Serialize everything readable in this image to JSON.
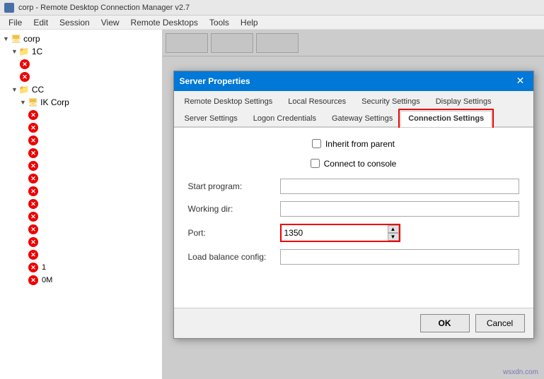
{
  "window": {
    "title": "corp - Remote Desktop Connection Manager v2.7",
    "icon": "monitor-icon"
  },
  "menubar": {
    "items": [
      "File",
      "Edit",
      "Session",
      "View",
      "Remote Desktops",
      "Tools",
      "Help"
    ]
  },
  "sidebar": {
    "tree": [
      {
        "label": "corp",
        "level": 0,
        "type": "root",
        "expanded": true
      },
      {
        "label": "1C",
        "level": 1,
        "type": "folder",
        "expanded": true,
        "hasError": false
      },
      {
        "label": "",
        "level": 2,
        "type": "error-node",
        "hasError": true
      },
      {
        "label": "",
        "level": 2,
        "type": "error-node",
        "hasError": true
      },
      {
        "label": "CC",
        "level": 1,
        "type": "folder",
        "expanded": true,
        "hasError": false
      },
      {
        "label": "IK Corp",
        "level": 2,
        "type": "server",
        "hasError": false
      },
      {
        "label": "",
        "level": 3,
        "type": "error-node",
        "hasError": true
      },
      {
        "label": "",
        "level": 3,
        "type": "error-node",
        "hasError": true
      },
      {
        "label": "",
        "level": 3,
        "type": "error-node",
        "hasError": true
      },
      {
        "label": "",
        "level": 3,
        "type": "error-node",
        "hasError": true
      },
      {
        "label": "",
        "level": 3,
        "type": "error-node",
        "hasError": true
      },
      {
        "label": "",
        "level": 3,
        "type": "error-node",
        "hasError": true
      },
      {
        "label": "",
        "level": 3,
        "type": "error-node",
        "hasError": true
      },
      {
        "label": "",
        "level": 3,
        "type": "error-node",
        "hasError": true
      },
      {
        "label": "",
        "level": 3,
        "type": "error-node",
        "hasError": true
      },
      {
        "label": "",
        "level": 3,
        "type": "error-node",
        "hasError": true
      },
      {
        "label": "",
        "level": 3,
        "type": "error-node",
        "hasError": true
      },
      {
        "label": "",
        "level": 3,
        "type": "error-node",
        "hasError": true
      },
      {
        "label": "1",
        "level": 3,
        "type": "server-label",
        "hasError": true
      },
      {
        "label": "0M",
        "level": 3,
        "type": "server-label",
        "hasError": true
      }
    ]
  },
  "toolbar": {
    "buttons": [
      "",
      "",
      ""
    ]
  },
  "dialog": {
    "title": "Server Properties",
    "close_button_label": "✕",
    "tabs": [
      {
        "id": "remote-desktop",
        "label": "Remote Desktop Settings",
        "active": false
      },
      {
        "id": "local-resources",
        "label": "Local Resources",
        "active": false
      },
      {
        "id": "security-settings",
        "label": "Security Settings",
        "active": false
      },
      {
        "id": "display-settings",
        "label": "Display Settings",
        "active": false
      },
      {
        "id": "server-settings",
        "label": "Server Settings",
        "active": false
      },
      {
        "id": "logon-credentials",
        "label": "Logon Credentials",
        "active": false
      },
      {
        "id": "gateway-settings",
        "label": "Gateway Settings",
        "active": false
      },
      {
        "id": "connection-settings",
        "label": "Connection Settings",
        "active": true
      }
    ],
    "inherit_checkbox": {
      "label": "Inherit from parent",
      "checked": false
    },
    "connect_console_checkbox": {
      "label": "Connect to console",
      "checked": false
    },
    "fields": {
      "start_program": {
        "label": "Start program:",
        "value": ""
      },
      "working_dir": {
        "label": "Working dir:",
        "value": ""
      },
      "port": {
        "label": "Port:",
        "value": "1350"
      },
      "load_balance": {
        "label": "Load balance config:",
        "value": ""
      }
    },
    "footer": {
      "ok_label": "OK",
      "cancel_label": "Cancel"
    }
  },
  "watermark": {
    "text": "wsxdn.com"
  }
}
